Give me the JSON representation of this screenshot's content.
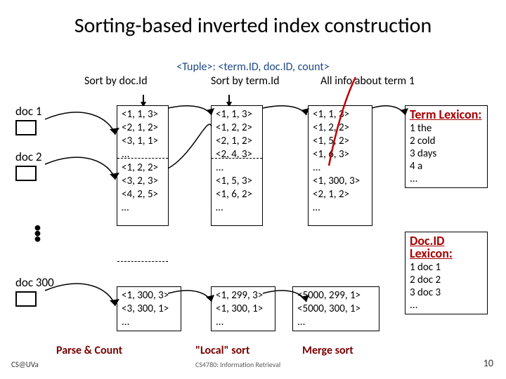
{
  "title": "Sorting-based inverted index construction",
  "tuple_header": "<Tuple>: <term.ID, doc.ID, count>",
  "sort_labels": {
    "docid": "Sort by doc.Id",
    "termid": "Sort by term.Id",
    "allinfo": "All info about term 1"
  },
  "docs": {
    "d1": "doc 1",
    "d2": "doc 2",
    "d300": "doc 300",
    "dots": "⋮"
  },
  "col1_top": [
    "<1, 1, 3>",
    "<2, 1, 2>",
    "<3, 1, 1>",
    "...",
    "<1, 2, 2>",
    "<3, 2, 3>",
    "<4, 2, 5>",
    "…"
  ],
  "col1_bot": [
    "<1, 300, 3>",
    "<3, 300, 1>",
    "..."
  ],
  "col2_top": [
    "<1, 1, 3>",
    "<1, 2, 2>",
    "<2, 1, 2>",
    "<2, 4, 3>",
    "...",
    "<1, 5, 3>",
    "<1, 6, 2>",
    "…"
  ],
  "col2_bot": [
    "<1, 299, 3>",
    "<1, 300, 1>",
    "..."
  ],
  "col3_top": [
    "<1, 1, 3>",
    "<1, 2, 2>",
    "<1, 5, 2>",
    "<1, 6, 3>",
    "...",
    "<1, 300, 3>",
    "<2, 1, 2>",
    "…"
  ],
  "col3_bot": [
    "<5000, 299, 1>",
    "<5000, 300, 1>",
    "..."
  ],
  "term_lex": {
    "title": "Term Lexicon:",
    "rows": [
      "1 the",
      "2 cold",
      "3 days",
      "4 a",
      "..."
    ]
  },
  "docid_lex": {
    "title": "Doc.ID Lexicon:",
    "rows": [
      "1 doc 1",
      "2 doc 2",
      "3 doc 3",
      "..."
    ]
  },
  "bottom": {
    "parse": "Parse & Count",
    "local": "\"Local\" sort",
    "merge": "Merge sort",
    "sub": "CS4780: Information Retrieval"
  },
  "footer": {
    "left": "CS@UVa",
    "page": "10"
  }
}
